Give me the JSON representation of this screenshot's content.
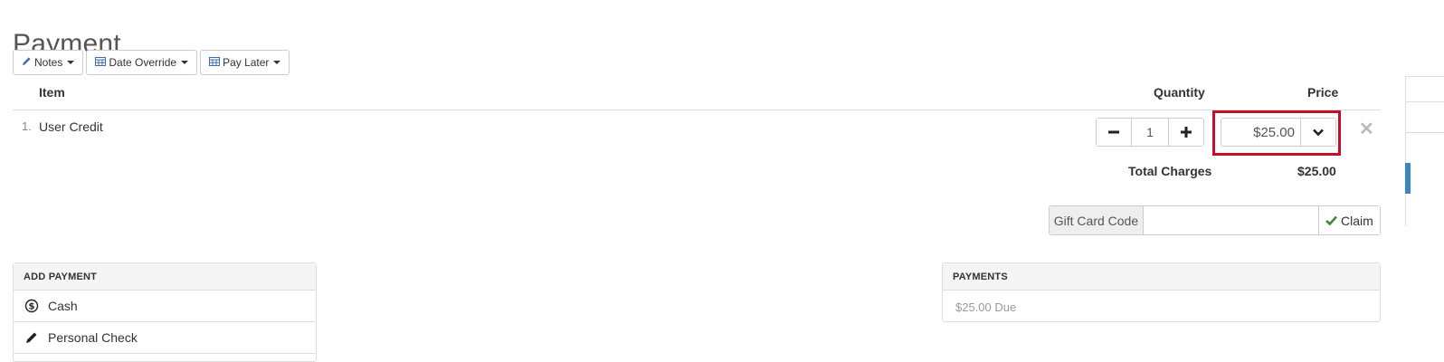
{
  "page": {
    "title": "Payment"
  },
  "toolbar": {
    "notes_label": "Notes",
    "date_override_label": "Date Override",
    "pay_later_label": "Pay Later"
  },
  "table": {
    "headers": {
      "item": "Item",
      "quantity": "Quantity",
      "price": "Price"
    },
    "rows": [
      {
        "index": "1.",
        "name": "User Credit",
        "quantity": "1",
        "price": "$25.00"
      }
    ]
  },
  "totals": {
    "label": "Total Charges",
    "value": "$25.00"
  },
  "gift_card": {
    "label": "Gift Card Code",
    "value": "",
    "claim_label": "Claim"
  },
  "add_payment": {
    "title": "ADD PAYMENT",
    "methods": [
      {
        "label": "Cash",
        "icon": "dollar-circle-icon"
      },
      {
        "label": "Personal Check",
        "icon": "pen-icon"
      }
    ]
  },
  "payments": {
    "title": "PAYMENTS",
    "due_text": "$25.00 Due"
  },
  "colors": {
    "highlight": "#c0102a",
    "accent_blue": "#3a87c8",
    "check_green": "#3c8a3c"
  }
}
